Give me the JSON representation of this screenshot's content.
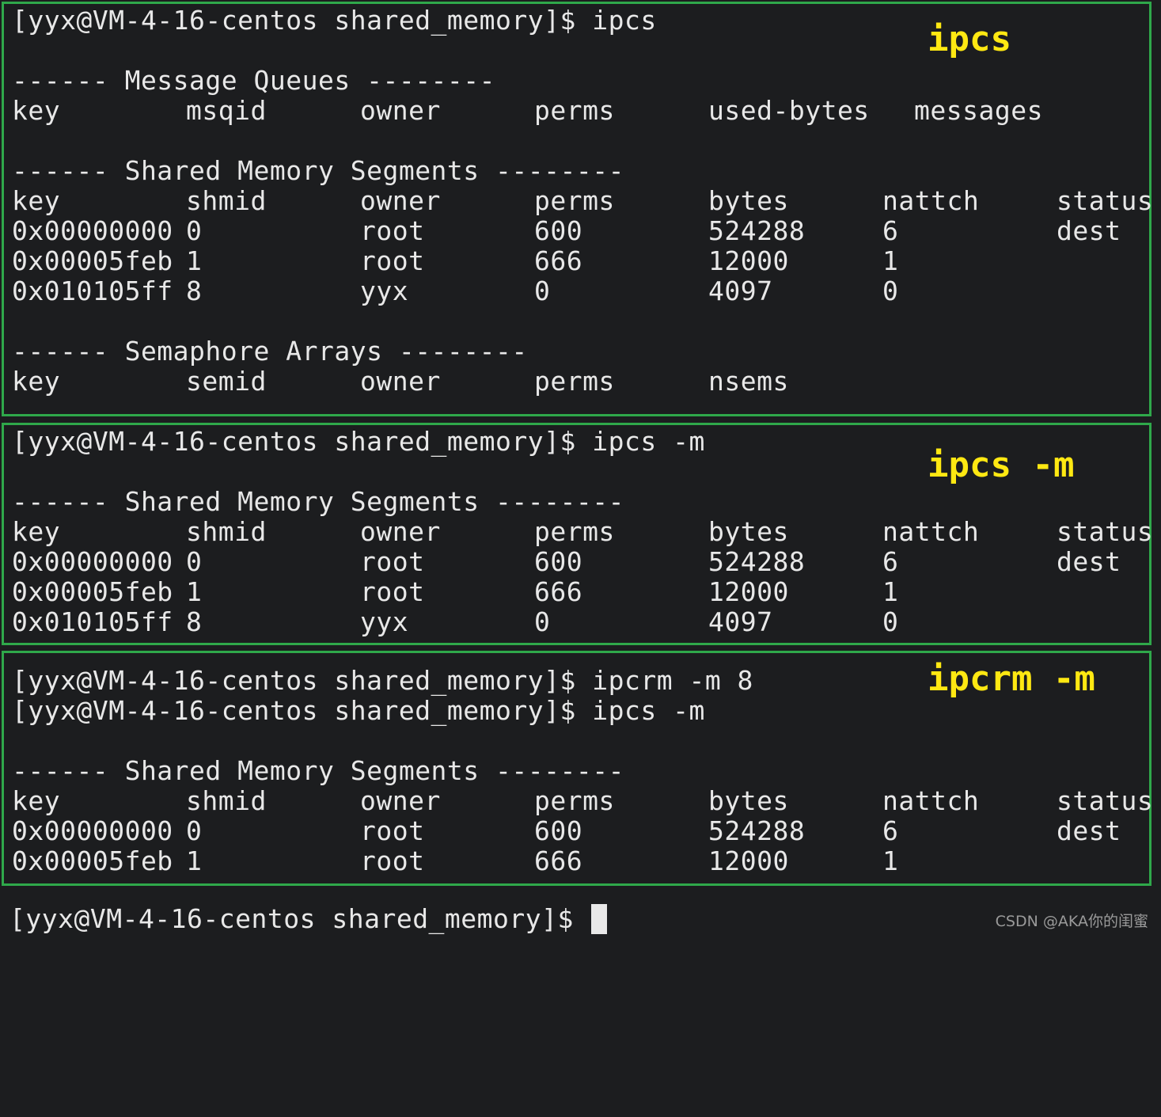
{
  "prompt": "[yyx@VM-4-16-centos shared_memory]$ ",
  "colors": {
    "background": "#1c1d1f",
    "text": "#e8e8e8",
    "panel_border": "#2fa84a",
    "annotation": "#ffe812"
  },
  "panel1": {
    "command": "ipcs",
    "annotation": "ipcs",
    "msg_title": "------ Message Queues --------",
    "msg_headers": [
      "key",
      "msqid",
      "owner",
      "perms",
      "used-bytes",
      "messages"
    ],
    "shm_title": "------ Shared Memory Segments --------",
    "shm_headers": [
      "key",
      "shmid",
      "owner",
      "perms",
      "bytes",
      "nattch",
      "status"
    ],
    "shm_rows": [
      [
        "0x00000000",
        "0",
        "root",
        "600",
        "524288",
        "6",
        "dest"
      ],
      [
        "0x00005feb",
        "1",
        "root",
        "666",
        "12000",
        "1",
        ""
      ],
      [
        "0x010105ff",
        "8",
        "yyx",
        "0",
        "4097",
        "0",
        ""
      ]
    ],
    "sem_title": "------ Semaphore Arrays --------",
    "sem_headers": [
      "key",
      "semid",
      "owner",
      "perms",
      "nsems"
    ]
  },
  "panel2": {
    "command": "ipcs -m",
    "annotation": "ipcs -m",
    "shm_title": "------ Shared Memory Segments --------",
    "shm_headers": [
      "key",
      "shmid",
      "owner",
      "perms",
      "bytes",
      "nattch",
      "status"
    ],
    "shm_rows": [
      [
        "0x00000000",
        "0",
        "root",
        "600",
        "524288",
        "6",
        "dest"
      ],
      [
        "0x00005feb",
        "1",
        "root",
        "666",
        "12000",
        "1",
        ""
      ],
      [
        "0x010105ff",
        "8",
        "yyx",
        "0",
        "4097",
        "0",
        ""
      ]
    ]
  },
  "panel3": {
    "command1": "ipcrm -m 8",
    "command2": "ipcs -m",
    "annotation": "ipcrm -m",
    "shm_title": "------ Shared Memory Segments --------",
    "shm_headers": [
      "key",
      "shmid",
      "owner",
      "perms",
      "bytes",
      "nattch",
      "status"
    ],
    "shm_rows": [
      [
        "0x00000000",
        "0",
        "root",
        "600",
        "524288",
        "6",
        "dest"
      ],
      [
        "0x00005feb",
        "1",
        "root",
        "666",
        "12000",
        "1",
        ""
      ]
    ]
  },
  "final_prompt": "[yyx@VM-4-16-centos shared_memory]$",
  "watermark": "CSDN @AKA你的闺蜜"
}
